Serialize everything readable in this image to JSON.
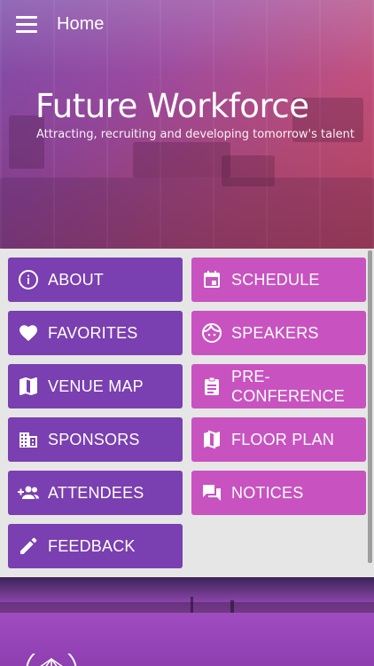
{
  "appbar": {
    "title": "Home",
    "menu_icon": "hamburger-icon"
  },
  "hero": {
    "title": "Future Workforce",
    "subtitle": "Attracting, recruiting and developing tomorrow's talent"
  },
  "colors": {
    "tile_left": "#7a3fb0",
    "tile_right": "#c853c0"
  },
  "tiles": [
    {
      "label": "ABOUT",
      "icon": "info-icon"
    },
    {
      "label": "SCHEDULE",
      "icon": "calendar-icon"
    },
    {
      "label": "FAVORITES",
      "icon": "heart-icon"
    },
    {
      "label": "SPEAKERS",
      "icon": "face-icon"
    },
    {
      "label": "VENUE MAP",
      "icon": "map-icon"
    },
    {
      "label": "PRE-\nCONFERENCE",
      "icon": "clipboard-icon"
    },
    {
      "label": "SPONSORS",
      "icon": "building-icon"
    },
    {
      "label": "FLOOR PLAN",
      "icon": "map-icon"
    },
    {
      "label": "ATTENDEES",
      "icon": "group-add-icon"
    },
    {
      "label": "NOTICES",
      "icon": "chat-icon"
    },
    {
      "label": "FEEDBACK",
      "icon": "pencil-icon"
    }
  ]
}
